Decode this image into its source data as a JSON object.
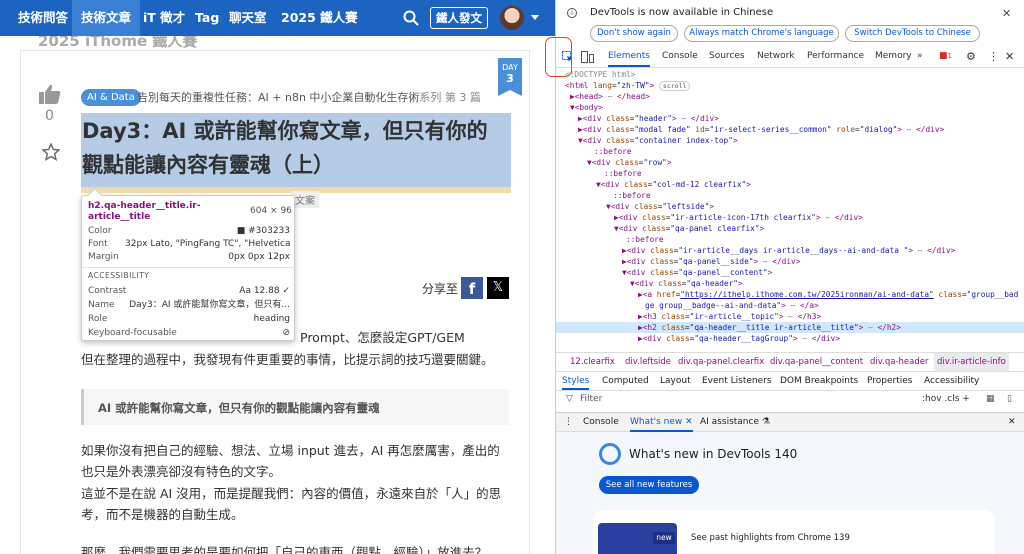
{
  "nav": {
    "items": [
      "技術問答",
      "技術文章",
      "iT 徵才",
      "Tag",
      "聊天室",
      "2025 鐵人賽"
    ],
    "write_label": "鐵人發文"
  },
  "page": {
    "ghost_title": "2025 iThome 鐵人賽",
    "like_count": "0",
    "day_label": "DAY",
    "day_number": "3",
    "tag": "AI & Data",
    "series_title": "告別每天的重複性任務：AI + n8n 中小企業自動化生存術",
    "series_suffix": "系列 第 3 篇",
    "title_line1": "Day3：AI 或許能幫你寫文章，但只有你的",
    "title_line2": "觀點能讓內容有靈魂（上）",
    "hidden_chip": "文案",
    "share_label": "分享至",
    "para1_fragment": "Prompt、怎麼設定GPT/GEM",
    "para2": "但在整理的過程中，我發現有件更重要的事情，比提示詞的技巧還要關鍵。",
    "quote": "AI 或許能幫你寫文章，但只有你的觀點能讓內容有靈魂",
    "para3_line1": "如果你沒有把自己的經驗、想法、立場 input 進去，AI 再怎麼厲害，產出的",
    "para3_line2": "也只是外表漂亮卻沒有特色的文字。",
    "para4_line1": "這並不是在說 AI 沒用，而是提醒我們：內容的價值，永遠來自於「人」的思",
    "para4_line2": "考，而不是機器的自動生成。",
    "para5_fragment": "那麼，我們需要思考的是要如何把「自己的東西（觀點、經驗）」放進去？"
  },
  "tooltip": {
    "selector": "h2.qa-header__title.ir-article__title",
    "size": "604 × 96",
    "rows": [
      {
        "label": "Color",
        "value": "■ #303233"
      },
      {
        "label": "Font",
        "value": "32px Lato, \"PingFang TC\", \"Helvetica ..."
      },
      {
        "label": "Margin",
        "value": "0px 0px 12px"
      }
    ],
    "accessibility_header": "ACCESSIBILITY",
    "acc_rows": [
      {
        "label": "Contrast",
        "value": "Aa  12.88 ✓"
      },
      {
        "label": "Name",
        "value": "Day3：AI 或許能幫你寫文章，但只有..."
      },
      {
        "label": "Role",
        "value": "heading"
      },
      {
        "label": "Keyboard-focusable",
        "value": "⊘"
      }
    ]
  },
  "devtools": {
    "info_text": "DevTools is now available in Chinese",
    "info_buttons": [
      "Don't show again",
      "Always match Chrome's language",
      "Switch DevTools to Chinese"
    ],
    "tabs": [
      "Elements",
      "Console",
      "Sources",
      "Network",
      "Performance",
      "Memory"
    ],
    "issues_count": "1",
    "dom_lines": [
      "<!DOCTYPE html>",
      "<html lang=\"zh-TW\"> scroll",
      "▶<head> ⋯ </head>",
      "▼<body>",
      "▶<div class=\"header\"> ⋯ </div>",
      "▶<div class=\"modal fade\" id=\"ir-select-series__common\" role=\"dialog\"> ⋯ </div>",
      "▼<div class=\"container index-top\">",
      "::before",
      "▼<div class=\"row\">",
      "::before",
      "▼<div class=\"col-md-12 clearfix\">",
      "::before",
      "▼<div class=\"leftside\">",
      "▶<div class=\"ir-article-icon-17th clearfix\"> ⋯ </div>",
      "▼<div class=\"qa-panel clearfix\">",
      "::before",
      "▶<div class=\"ir-article__days ir-article__days--ai-and-data \"> ⋯ </div>",
      "▶<div class=\"qa-panel__side\"> ⋯ </div>",
      "▼<div class=\"qa-panel__content\">",
      "▼<div class=\"qa-header\">",
      "▶<a href=\"https://ithelp.ithome.com.tw/2025ironman/ai-and-data\" class=\"group__bad",
      "ge group__badge--ai-and-data\"> ⋯ </a>",
      "▶<h3 class=\"ir-article__topic\"> ⋯ </h3>",
      "▶<h2 class=\"qa-header__title ir-article__title\"> ⋯ </h2>",
      "▶<div class=\"qa-header__tagGroup\"> ⋯ </div>"
    ],
    "crumbs": [
      "12.clearfix",
      "div.leftside",
      "div.qa-panel.clearfix",
      "div.qa-panel__content",
      "div.qa-header",
      "div.ir-article-info"
    ],
    "style_tabs": [
      "Styles",
      "Computed",
      "Layout",
      "Event Listeners",
      "DOM Breakpoints",
      "Properties",
      "Accessibility"
    ],
    "filter_placeholder": "Filter",
    "filter_tools": ":hov  .cls  +",
    "drawer_tabs": [
      "Console",
      "What's new",
      "AI assistance"
    ],
    "whats_new_title": "What's new in DevTools 140",
    "see_all": "See all new features",
    "new_badge": "new",
    "card_text": "See past highlights from Chrome 139"
  },
  "colors": {
    "nav_bg": "#1d64c0",
    "title": "#303233",
    "accent": "#0b57d0",
    "highlight": "#e0472b"
  }
}
